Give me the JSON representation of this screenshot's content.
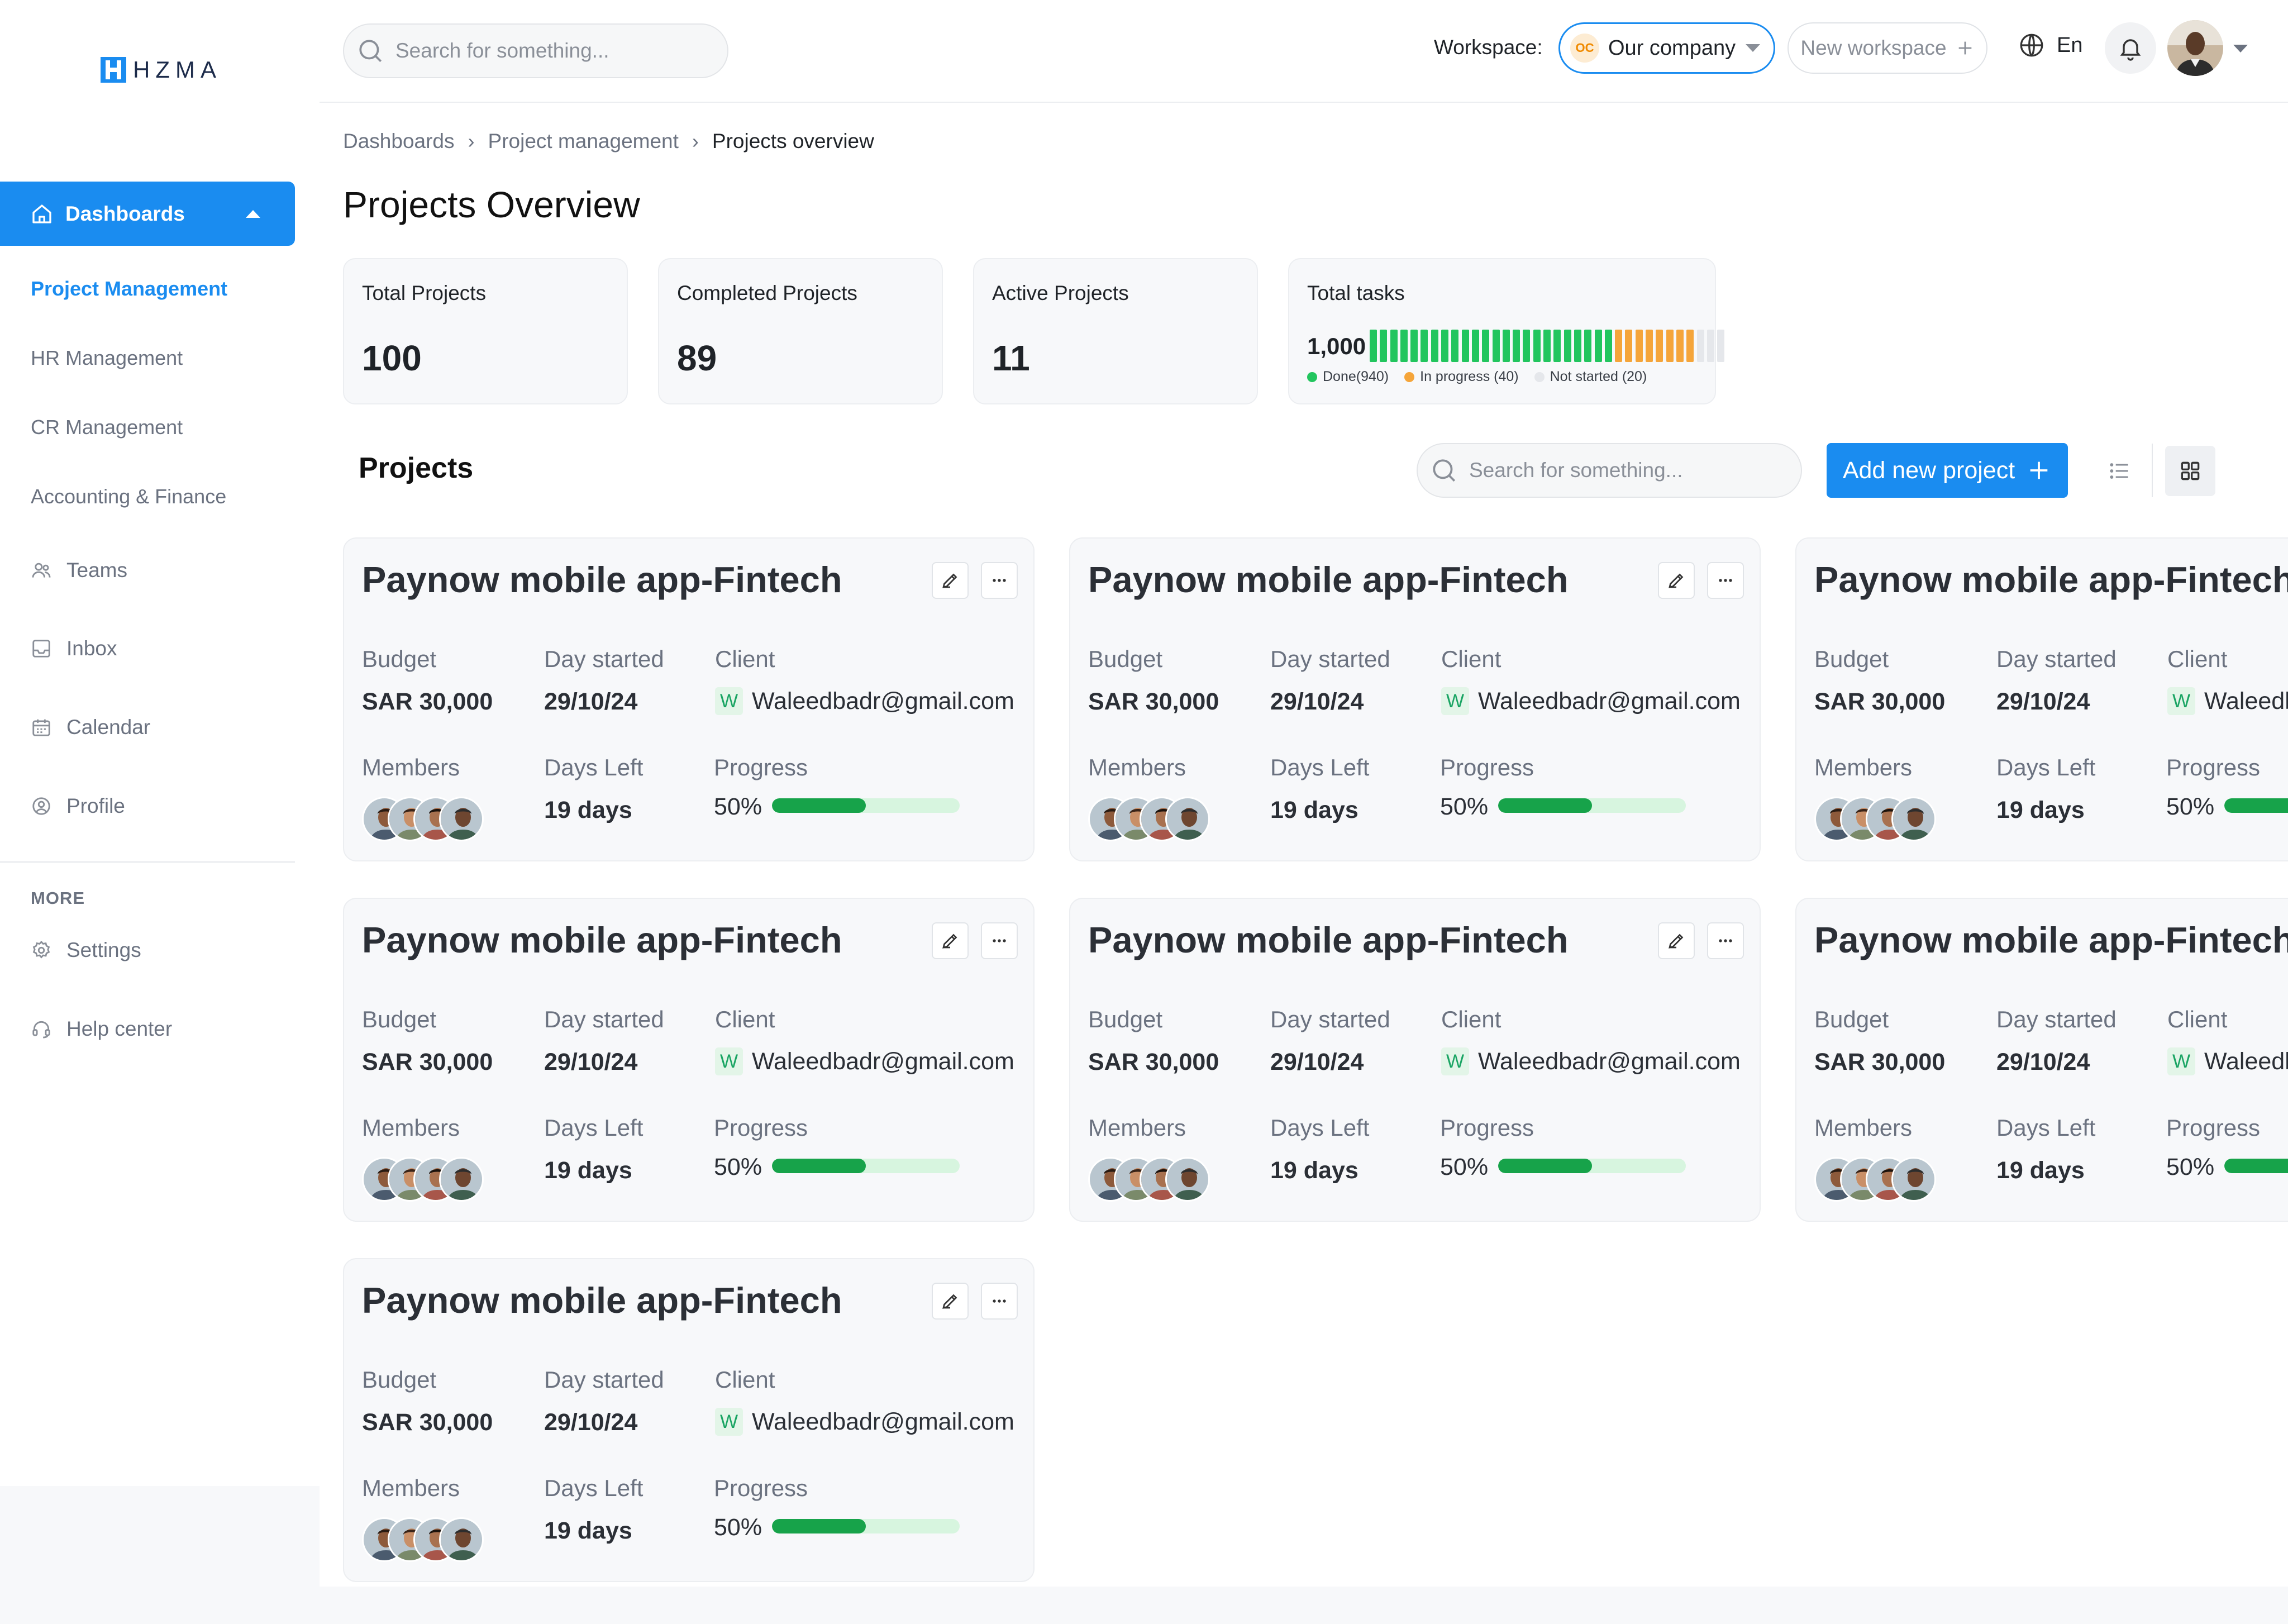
{
  "app": {
    "logo_text": "HZMA"
  },
  "sidebar": {
    "dashboards_label": "Dashboards",
    "sub_items": [
      {
        "label": "Project Management",
        "active": true
      },
      {
        "label": "HR Management"
      },
      {
        "label": "CR Management"
      },
      {
        "label": "Accounting & Finance"
      }
    ],
    "items": [
      {
        "label": "Teams",
        "icon": "users-icon"
      },
      {
        "label": "Inbox",
        "icon": "inbox-icon"
      },
      {
        "label": "Calendar",
        "icon": "calendar-icon"
      },
      {
        "label": "Profile",
        "icon": "user-circle-icon"
      }
    ],
    "more_label": "MORE",
    "more_items": [
      {
        "label": "Settings",
        "icon": "gear-icon"
      },
      {
        "label": "Help center",
        "icon": "headset-icon"
      }
    ]
  },
  "topbar": {
    "search_placeholder": "Search for something...",
    "workspace_label": "Workspace:",
    "workspace_badge": "OC",
    "workspace_value": "Our company",
    "new_workspace_label": "New workspace",
    "language": "En"
  },
  "breadcrumb": [
    "Dashboards",
    "Project management",
    "Projects overview"
  ],
  "page_title": "Projects Overview",
  "stats": {
    "total_projects": {
      "label": "Total Projects",
      "value": "100"
    },
    "completed_projects": {
      "label": "Completed Projects",
      "value": "89"
    },
    "active_projects": {
      "label": "Active Projects",
      "value": "11"
    },
    "total_tasks": {
      "label": "Total tasks",
      "value": "1,000",
      "segments": {
        "done": 940,
        "in_progress": 40,
        "not_started": 20
      },
      "bar_counts": {
        "done": 24,
        "in_progress": 8,
        "not_started": 3
      },
      "legend": [
        {
          "label": "Done(940)",
          "color": "#22c55e"
        },
        {
          "label": "In progress (40)",
          "color": "#f5a53a"
        },
        {
          "label": "Not started (20)",
          "color": "#e5e7eb"
        }
      ]
    }
  },
  "projects_section": {
    "heading": "Projects",
    "search_placeholder": "Search for something...",
    "add_button_label": "Add new project"
  },
  "card_labels": {
    "budget": "Budget",
    "day_started": "Day started",
    "client": "Client",
    "members": "Members",
    "days_left": "Days Left",
    "progress": "Progress"
  },
  "projects": [
    {
      "title": "Paynow mobile app-Fintech",
      "budget": "SAR 30,000",
      "day_started": "29/10/24",
      "client_badge": "W",
      "client": "Waleedbadr@gmail.com",
      "days_left": "19 days",
      "progress_label": "50%",
      "progress": 0.5
    },
    {
      "title": "Paynow mobile app-Fintech",
      "budget": "SAR 30,000",
      "day_started": "29/10/24",
      "client_badge": "W",
      "client": "Waleedbadr@gmail.com",
      "days_left": "19 days",
      "progress_label": "50%",
      "progress": 0.5
    },
    {
      "title": "Paynow mobile app-Fintech",
      "budget": "SAR 30,000",
      "day_started": "29/10/24",
      "client_badge": "W",
      "client": "Waleedbadr@gmail.com",
      "days_left": "19 days",
      "progress_label": "50%",
      "progress": 0.5
    },
    {
      "title": "Paynow mobile app-Fintech",
      "budget": "SAR 30,000",
      "day_started": "29/10/24",
      "client_badge": "W",
      "client": "Waleedbadr@gmail.com",
      "days_left": "19 days",
      "progress_label": "50%",
      "progress": 0.5
    },
    {
      "title": "Paynow mobile app-Fintech",
      "budget": "SAR 30,000",
      "day_started": "29/10/24",
      "client_badge": "W",
      "client": "Waleedbadr@gmail.com",
      "days_left": "19 days",
      "progress_label": "50%",
      "progress": 0.5
    },
    {
      "title": "Paynow mobile app-Fintech",
      "budget": "SAR 30,000",
      "day_started": "29/10/24",
      "client_badge": "W",
      "client": "Waleedbadr@gmail.com",
      "days_left": "19 days",
      "progress_label": "50%",
      "progress": 0.5
    },
    {
      "title": "Paynow mobile app-Fintech",
      "budget": "SAR 30,000",
      "day_started": "29/10/24",
      "client_badge": "W",
      "client": "Waleedbadr@gmail.com",
      "days_left": "19 days",
      "progress_label": "50%",
      "progress": 0.5
    }
  ],
  "colors": {
    "accent": "#1a8cf0",
    "done": "#22c55e",
    "in_progress": "#f5a53a",
    "not_started": "#e5e7eb",
    "progress_fill": "#17a34a",
    "progress_track": "#d7f5df"
  }
}
